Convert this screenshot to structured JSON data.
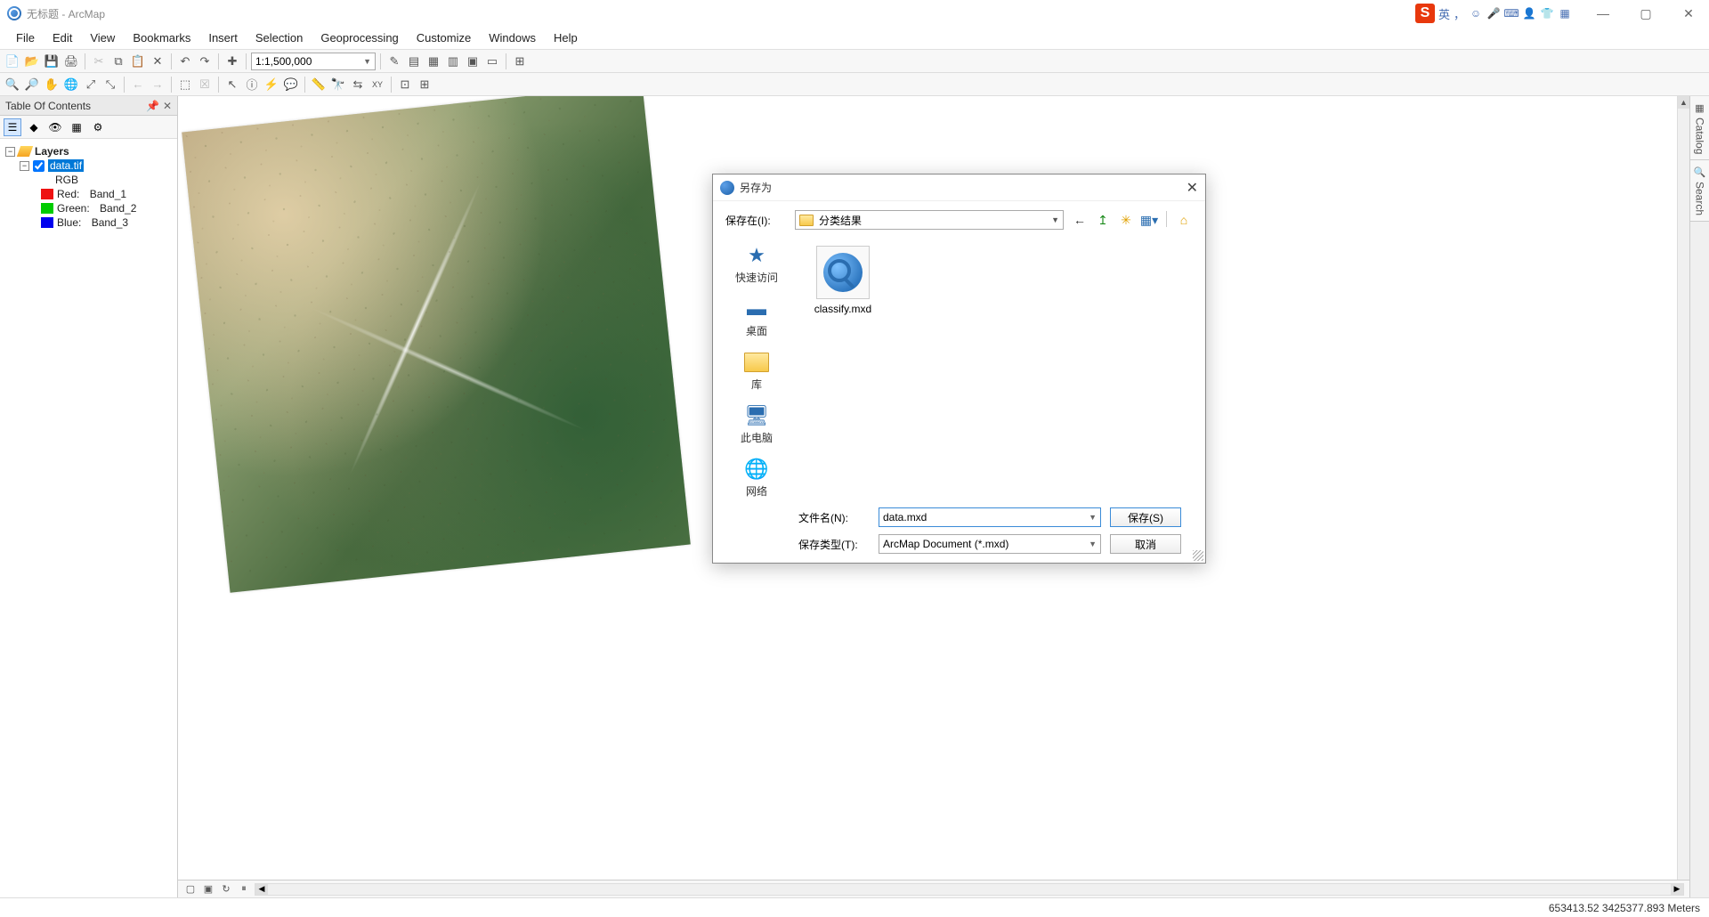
{
  "window": {
    "title": "无标题 - ArcMap",
    "ime": {
      "badge": "S",
      "lang": "英",
      "comma": "，"
    }
  },
  "menu": [
    "File",
    "Edit",
    "View",
    "Bookmarks",
    "Insert",
    "Selection",
    "Geoprocessing",
    "Customize",
    "Windows",
    "Help"
  ],
  "toolbar": {
    "scale": "1:1,500,000"
  },
  "toc": {
    "title": "Table Of Contents",
    "root": "Layers",
    "layer": "data.tif",
    "rgb_label": "RGB",
    "bands": [
      {
        "label": "Red:",
        "value": "Band_1",
        "color": "#e11"
      },
      {
        "label": "Green:",
        "value": "Band_2",
        "color": "#0c0"
      },
      {
        "label": "Blue:",
        "value": "Band_3",
        "color": "#00e"
      }
    ]
  },
  "side_tabs": [
    "Catalog",
    "Search"
  ],
  "status": {
    "coords": "653413.52 3425377.893 Meters"
  },
  "dialog": {
    "title": "另存为",
    "save_in_label": "保存在(I):",
    "location": "分类结果",
    "places": [
      {
        "key": "quick",
        "label": "快速访问",
        "icon": "★"
      },
      {
        "key": "desktop",
        "label": "桌面",
        "icon": "▬"
      },
      {
        "key": "lib",
        "label": "库",
        "icon": "folder"
      },
      {
        "key": "pc",
        "label": "此电脑",
        "icon": "pc"
      },
      {
        "key": "net",
        "label": "网络",
        "icon": "globe"
      }
    ],
    "files": [
      {
        "name": "classify.mxd"
      }
    ],
    "filename_label": "文件名(N):",
    "filename_value": "data.mxd",
    "filetype_label": "保存类型(T):",
    "filetype_value": "ArcMap Document (*.mxd)",
    "save_btn": "保存(S)",
    "cancel_btn": "取消"
  }
}
